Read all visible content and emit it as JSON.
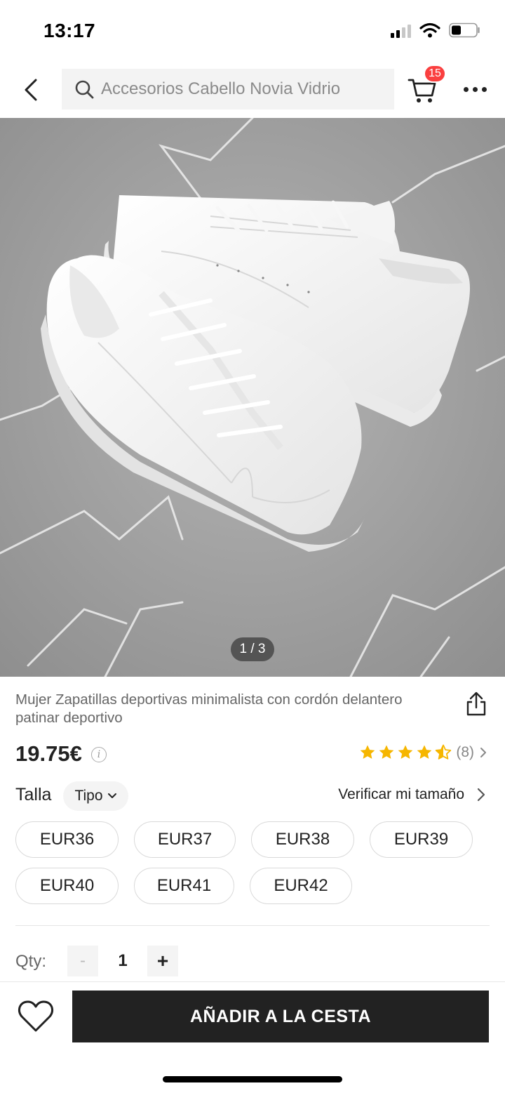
{
  "status_bar": {
    "time": "13:17"
  },
  "header": {
    "search_placeholder": "Accesorios Cabello Novia Vidrio",
    "cart_count": "15",
    "icons": [
      "chevron-left-icon",
      "search-icon",
      "cart-icon",
      "more-icon"
    ]
  },
  "gallery": {
    "counter": "1 / 3"
  },
  "product": {
    "title": "Mujer Zapatillas deportivas minimalista con cordón delantero patinar deportivo",
    "price": "19.75€",
    "rating_value": 4.5,
    "rating_count": "(8)"
  },
  "size": {
    "label": "Talla",
    "type_label": "Tipo",
    "verify_label": "Verificar mi tamaño",
    "options": [
      "EUR36",
      "EUR37",
      "EUR38",
      "EUR39",
      "EUR40",
      "EUR41",
      "EUR42"
    ]
  },
  "quantity": {
    "label": "Qty:",
    "minus": "-",
    "value": "1",
    "plus": "+"
  },
  "bottom_bar": {
    "add_to_cart": "AÑADIR A LA CESTA"
  },
  "colors": {
    "accent": "#222222",
    "badge": "#fa3f3f",
    "star": "#f6b600"
  }
}
